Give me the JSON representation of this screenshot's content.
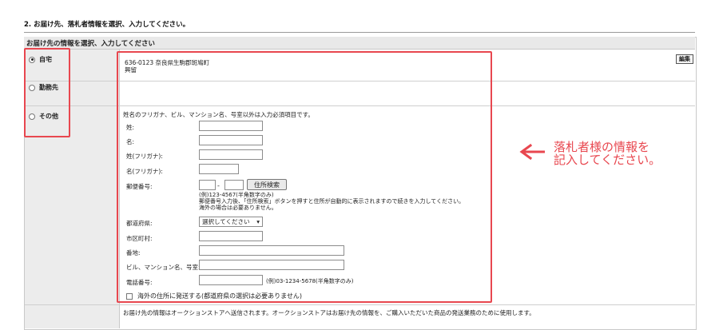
{
  "page": {
    "step_title": "2. お届け先、落札者情報を選択、入力してください。",
    "section_title": "お届け先の情報を選択、入力してください"
  },
  "destinations": [
    {
      "label": "自宅",
      "checked": true
    },
    {
      "label": "勤務先",
      "checked": false
    },
    {
      "label": "その他",
      "checked": false
    }
  ],
  "home_address": {
    "line1": "636-0123 奈良県生駒郡斑鳩町",
    "line2": "興留",
    "edit_label": "編集"
  },
  "form": {
    "note": "姓名のフリガナ、ビル、マンション名、号室以外は入力必須項目です。",
    "last_name_label": "姓:",
    "first_name_label": "名:",
    "last_name_kana_label": "姓(フリガナ):",
    "first_name_kana_label": "名(フリガナ):",
    "postal_label": "郵便番号:",
    "postal_dash": "-",
    "address_search_button": "住所検索",
    "postal_help_1": "(例)123-4567(半角数字のみ)",
    "postal_help_2": "郵便番号入力後、「住所検索」ボタンを押すと住所が自動的に表示されますので続きを入力してください。",
    "postal_help_3": "海外の場合は必要ありません。",
    "prefecture_label": "都道府県:",
    "prefecture_selected": "選択してください",
    "city_label": "市区町村:",
    "street_label": "番地:",
    "building_label": "ビル、マンション名、号室:",
    "phone_label": "電話番号:",
    "phone_help": "(例)03-1234-5678(半角数字のみ)",
    "overseas_checkbox_label": "海外の住所に発送する(都道府県の選択は必要ありません)"
  },
  "footer_note": "お届け先の情報はオークションストアへ送信されます。オークションストアはお届け先の情報を、ご購入いただいた商品の発送業務のために使用します。",
  "callout": {
    "line1": "落札者様の情報を",
    "line2": "記入してください。",
    "color": "#e8474f"
  }
}
